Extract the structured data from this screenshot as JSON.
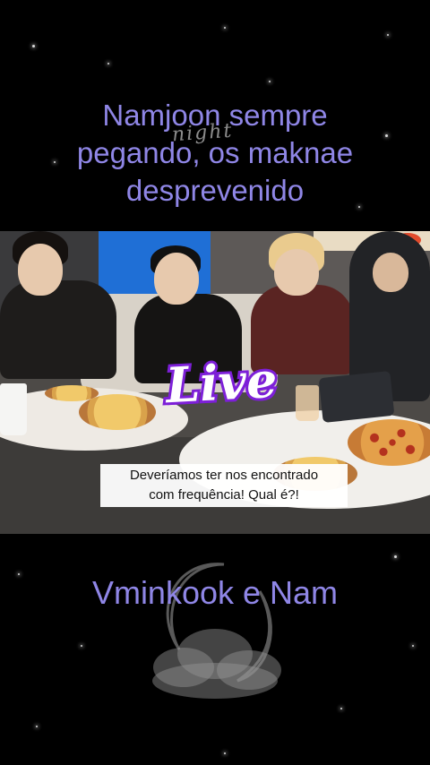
{
  "overlay": {
    "top_caption_line1": "Namjoon sempre",
    "top_caption_line2": "pegando, os maknae",
    "top_caption_line3": "desprevenido",
    "scribble": "night",
    "live_badge": "Live",
    "bottom_caption": "Vminkook e Nam"
  },
  "video": {
    "subtitle_line1": "Deveríamos ter nos encontrado",
    "subtitle_line2": "com frequência! Qual é?!"
  },
  "colors": {
    "caption": "#8f86e6",
    "live_outline": "#7d1fd8",
    "background": "#000000"
  },
  "icons": {
    "moon": "crescent-moon-icon",
    "cloud": "cloud-icon"
  }
}
